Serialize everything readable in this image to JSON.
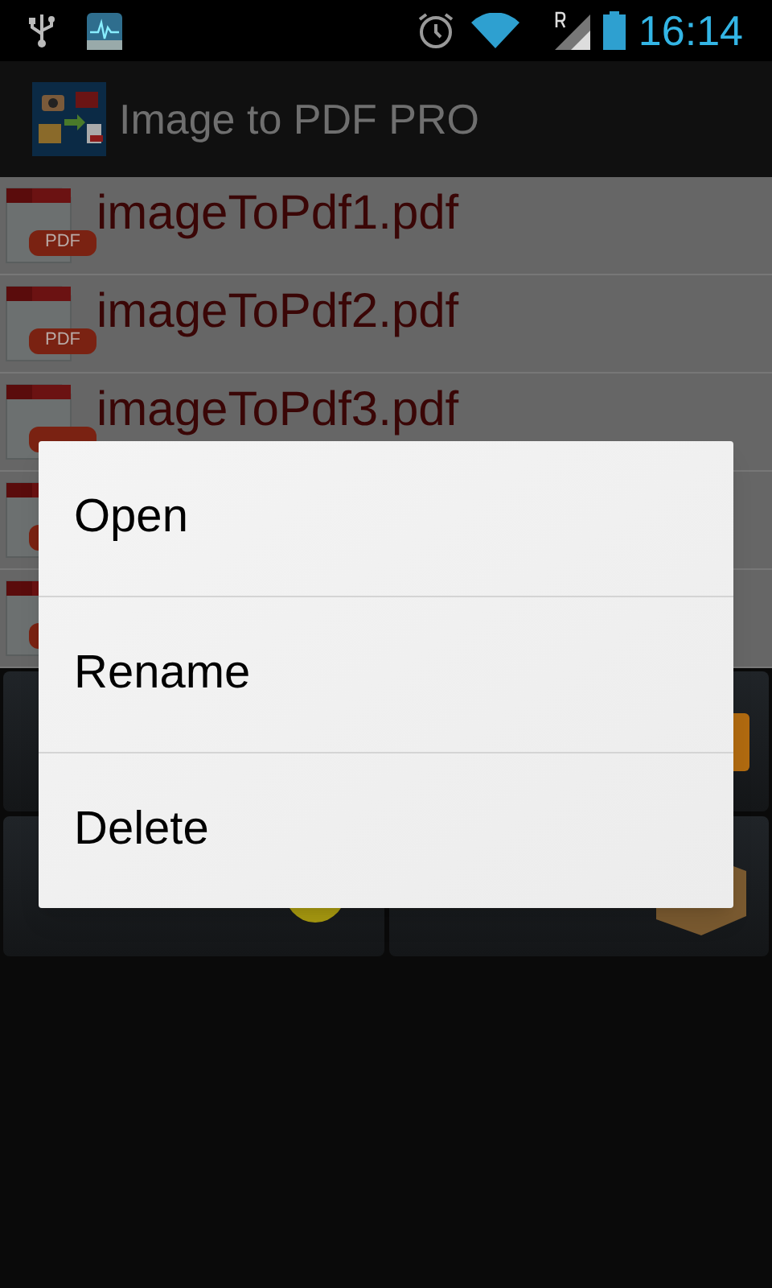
{
  "status_bar": {
    "time": "16:14"
  },
  "action_bar": {
    "title": "Image to PDF PRO"
  },
  "files": [
    {
      "kind": "pdf",
      "name": "imageToPdf1.pdf",
      "badge": "PDF"
    },
    {
      "kind": "pdf",
      "name": "imageToPdf2.pdf",
      "badge": "PDF"
    },
    {
      "kind": "pdf",
      "name": "imageToPdf3.pdf"
    },
    {
      "kind": "pdf"
    },
    {
      "kind": "pdf"
    }
  ],
  "context_menu": {
    "items": [
      {
        "label": "Open"
      },
      {
        "label": "Rename"
      },
      {
        "label": "Delete"
      }
    ]
  }
}
